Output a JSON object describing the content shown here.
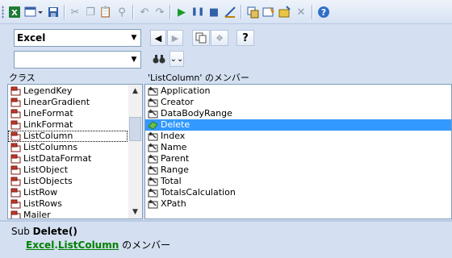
{
  "toolbar": {
    "icons": [
      "excel-icon",
      "object-icon",
      "save-icon",
      "cut-icon",
      "copy-icon",
      "paste-icon",
      "find-icon",
      "undo-icon",
      "redo-icon",
      "run-icon",
      "pause-icon",
      "stop-icon",
      "design-mode-icon",
      "project-explorer-icon",
      "properties-icon",
      "object-browser-icon",
      "toolbox-icon",
      "help-icon"
    ]
  },
  "library_select": {
    "value": "Excel"
  },
  "search_input": {
    "value": ""
  },
  "buttons": {
    "help_label": "?"
  },
  "classes_panel": {
    "title": "クラス",
    "items": [
      "LegendKey",
      "LinearGradient",
      "LineFormat",
      "LinkFormat",
      "ListColumn",
      "ListColumns",
      "ListDataFormat",
      "ListObject",
      "ListObjects",
      "ListRow",
      "ListRows",
      "Mailer"
    ],
    "selected": "ListColumn"
  },
  "members_panel": {
    "title": "'ListColumn' のメンバー",
    "items": [
      "Application",
      "Creator",
      "DataBodyRange",
      "Delete",
      "Index",
      "Name",
      "Parent",
      "Range",
      "Total",
      "TotalsCalculation",
      "XPath"
    ],
    "selected": "Delete"
  },
  "details": {
    "sub_prefix": "Sub",
    "sub_name": "Delete()",
    "library_link": "Excel",
    "dot": ".",
    "class_link": "ListColumn",
    "suffix": "のメンバー"
  },
  "colors": {
    "selection": "#3399ff",
    "link": "#008000",
    "background": "#d4e0f1"
  }
}
